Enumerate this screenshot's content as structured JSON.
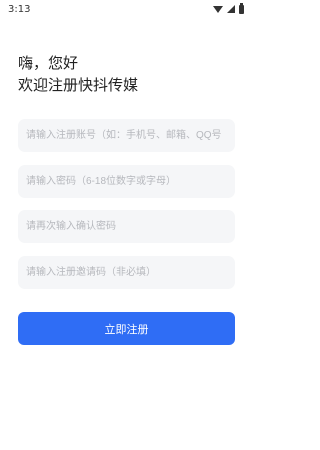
{
  "status_bar": {
    "time": "3:13"
  },
  "greeting": {
    "line1": "嗨，您好",
    "line2": "欢迎注册快抖传媒"
  },
  "form": {
    "account_placeholder": "请输入注册账号（如：手机号、邮箱、QQ号",
    "password_placeholder": "请输入密码（6-18位数字或字母）",
    "confirm_placeholder": "请再次输入确认密码",
    "invite_placeholder": "请输入注册邀请码（非必填）",
    "submit_label": "立即注册"
  },
  "colors": {
    "primary": "#2f6df5",
    "field_bg": "#f5f6f8",
    "placeholder": "#b6b8bd"
  },
  "icons": [
    "wifi-icon",
    "cell-signal-icon",
    "battery-icon"
  ]
}
